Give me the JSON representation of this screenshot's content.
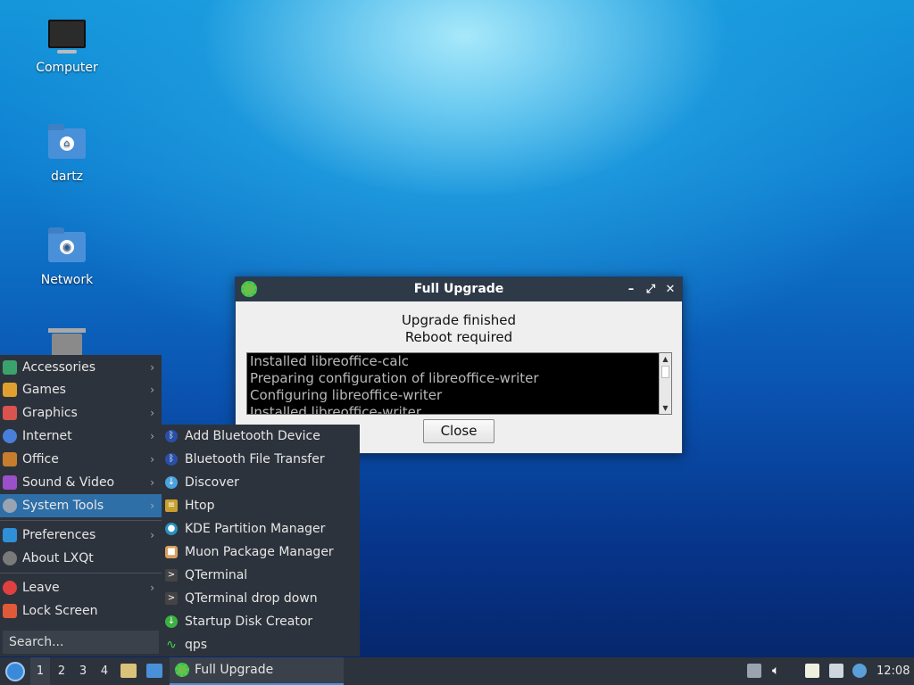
{
  "desktop": {
    "icons": [
      {
        "label": "Computer",
        "icon": "computer-icon"
      },
      {
        "label": "dartz",
        "icon": "home-folder-icon"
      },
      {
        "label": "Network",
        "icon": "network-folder-icon"
      },
      {
        "label": "",
        "icon": "trash-icon"
      }
    ]
  },
  "dialog": {
    "title": "Full Upgrade",
    "message_line1": "Upgrade finished",
    "message_line2": "Reboot required",
    "log_lines": [
      "Installed libreoffice-calc",
      "Preparing configuration of libreoffice-writer",
      "Configuring libreoffice-writer",
      "Installed libreoffice-writer"
    ],
    "close_label": "Close",
    "controls": {
      "minimize": "–",
      "maximize": "⤢",
      "close": "✕"
    }
  },
  "menu": {
    "items": [
      {
        "label": "Accessories",
        "color": "#3aa36b",
        "submenu": true
      },
      {
        "label": "Games",
        "color": "#e0a030",
        "submenu": true
      },
      {
        "label": "Graphics",
        "color": "#d9534f",
        "submenu": true
      },
      {
        "label": "Internet",
        "color": "#4a7fd9",
        "submenu": true
      },
      {
        "label": "Office",
        "color": "#c77d2e",
        "submenu": true
      },
      {
        "label": "Sound & Video",
        "color": "#9b4fc9",
        "submenu": true
      },
      {
        "label": "System Tools",
        "color": "#9aa4b0",
        "submenu": true,
        "active": true
      },
      {
        "label": "Preferences",
        "color": "#2f8fd8",
        "submenu": true
      },
      {
        "label": "About LXQt",
        "color": "#7a7a7a",
        "submenu": false
      },
      {
        "label": "Leave",
        "color": "#e04040",
        "submenu": true
      },
      {
        "label": "Lock Screen",
        "color": "#e05a3a",
        "submenu": false
      }
    ],
    "search_placeholder": "Search..."
  },
  "submenu": {
    "items": [
      {
        "label": "Add Bluetooth Device",
        "color": "#2a4fa8",
        "glyph": "ᛒ"
      },
      {
        "label": "Bluetooth File Transfer",
        "color": "#2a4fa8",
        "glyph": "ᛒ"
      },
      {
        "label": "Discover",
        "color": "#4aa3df",
        "glyph": "↓"
      },
      {
        "label": "Htop",
        "color": "#c8a030",
        "glyph": "≡"
      },
      {
        "label": "KDE Partition Manager",
        "color": "#2a8fbf",
        "glyph": "●"
      },
      {
        "label": "Muon Package Manager",
        "color": "#d8a060",
        "glyph": "■"
      },
      {
        "label": "QTerminal",
        "color": "#444",
        "glyph": ">"
      },
      {
        "label": "QTerminal drop down",
        "color": "#444",
        "glyph": ">"
      },
      {
        "label": "Startup Disk Creator",
        "color": "#3cb043",
        "glyph": "↓"
      },
      {
        "label": "qps",
        "color": "#2d333c",
        "glyph": "∿"
      }
    ]
  },
  "taskbar": {
    "workspaces": [
      "1",
      "2",
      "3",
      "4"
    ],
    "active_workspace": "1",
    "task_label": "Full Upgrade",
    "clock": "12:08"
  }
}
